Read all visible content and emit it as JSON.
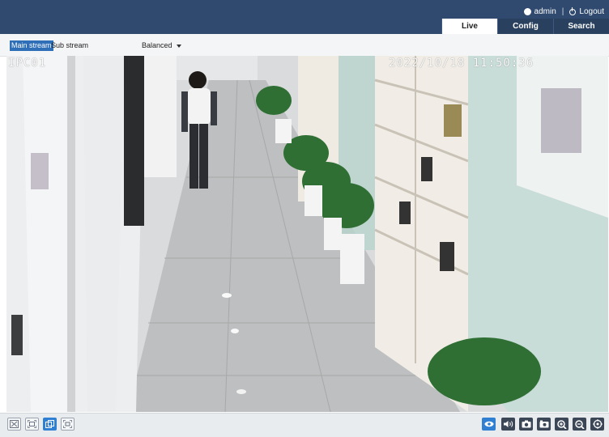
{
  "header": {
    "username": "admin",
    "logout_label": "Logout",
    "tabs": [
      {
        "label": "Live",
        "active": true
      },
      {
        "label": "Config",
        "active": false
      },
      {
        "label": "Search",
        "active": false
      }
    ]
  },
  "stream": {
    "main_label": "Main stream",
    "sub_label": "Sub stream",
    "quality_value": "Balanced",
    "selected": "main"
  },
  "video": {
    "camera_name": "IPC01",
    "timestamp": "2022/10/18 11:50:36"
  },
  "toolbar": {
    "left_icons": [
      "original-scale-icon",
      "fit-window-icon",
      "stretch-icon",
      "fullscreen-icon"
    ],
    "left_active": "stretch-icon",
    "right_icons": [
      "live-view-icon",
      "audio-icon",
      "snapshot-icon",
      "record-icon",
      "zoom-in-icon",
      "zoom-out-icon",
      "ptz-icon"
    ],
    "right_active": "live-view-icon"
  },
  "colors": {
    "header_bg": "#2f4a6e",
    "accent": "#2f7fd2",
    "stream_selected_bg": "#2f6fb7"
  }
}
